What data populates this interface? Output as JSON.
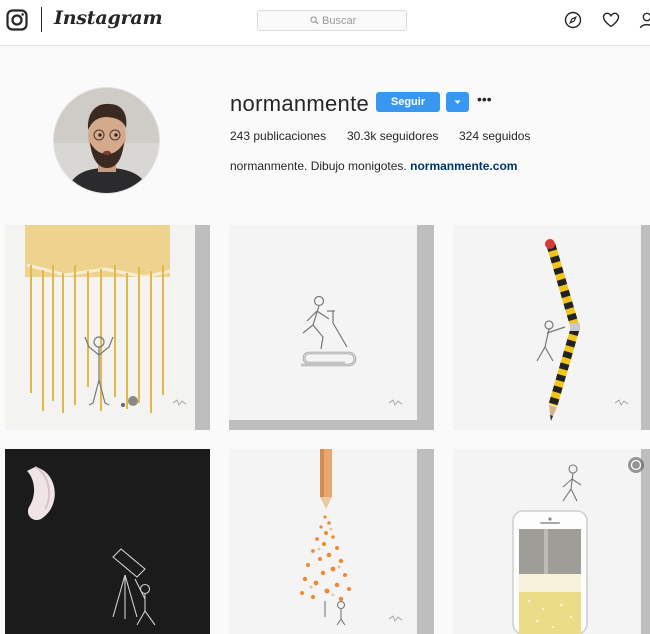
{
  "nav": {
    "brand": "Instagram",
    "search_placeholder": "Buscar",
    "icons": [
      "instagram-glyph-icon",
      "search-icon",
      "compass-icon",
      "heart-icon",
      "person-icon"
    ]
  },
  "profile": {
    "username": "normanmente",
    "follow_label": "Seguir",
    "more_label": "•••",
    "posts_count": "243",
    "posts_label": "publicaciones",
    "followers_count": "30.3k",
    "followers_label": "seguidores",
    "following_count": "324",
    "following_label": "seguidos",
    "bio_text": "normanmente. Dibujo monigotes.",
    "bio_link": "normanmente.com"
  },
  "posts": [
    {
      "name": "post-spaghetti-rain"
    },
    {
      "name": "post-paperclip-treadmill"
    },
    {
      "name": "post-pencil-climber"
    },
    {
      "name": "post-garlic-moon-telescope"
    },
    {
      "name": "post-colored-pencil-shavings-tree"
    },
    {
      "name": "post-phone-beer-glass"
    }
  ],
  "colors": {
    "accent": "#3897f0",
    "link": "#003569",
    "background": "#fafafa"
  }
}
